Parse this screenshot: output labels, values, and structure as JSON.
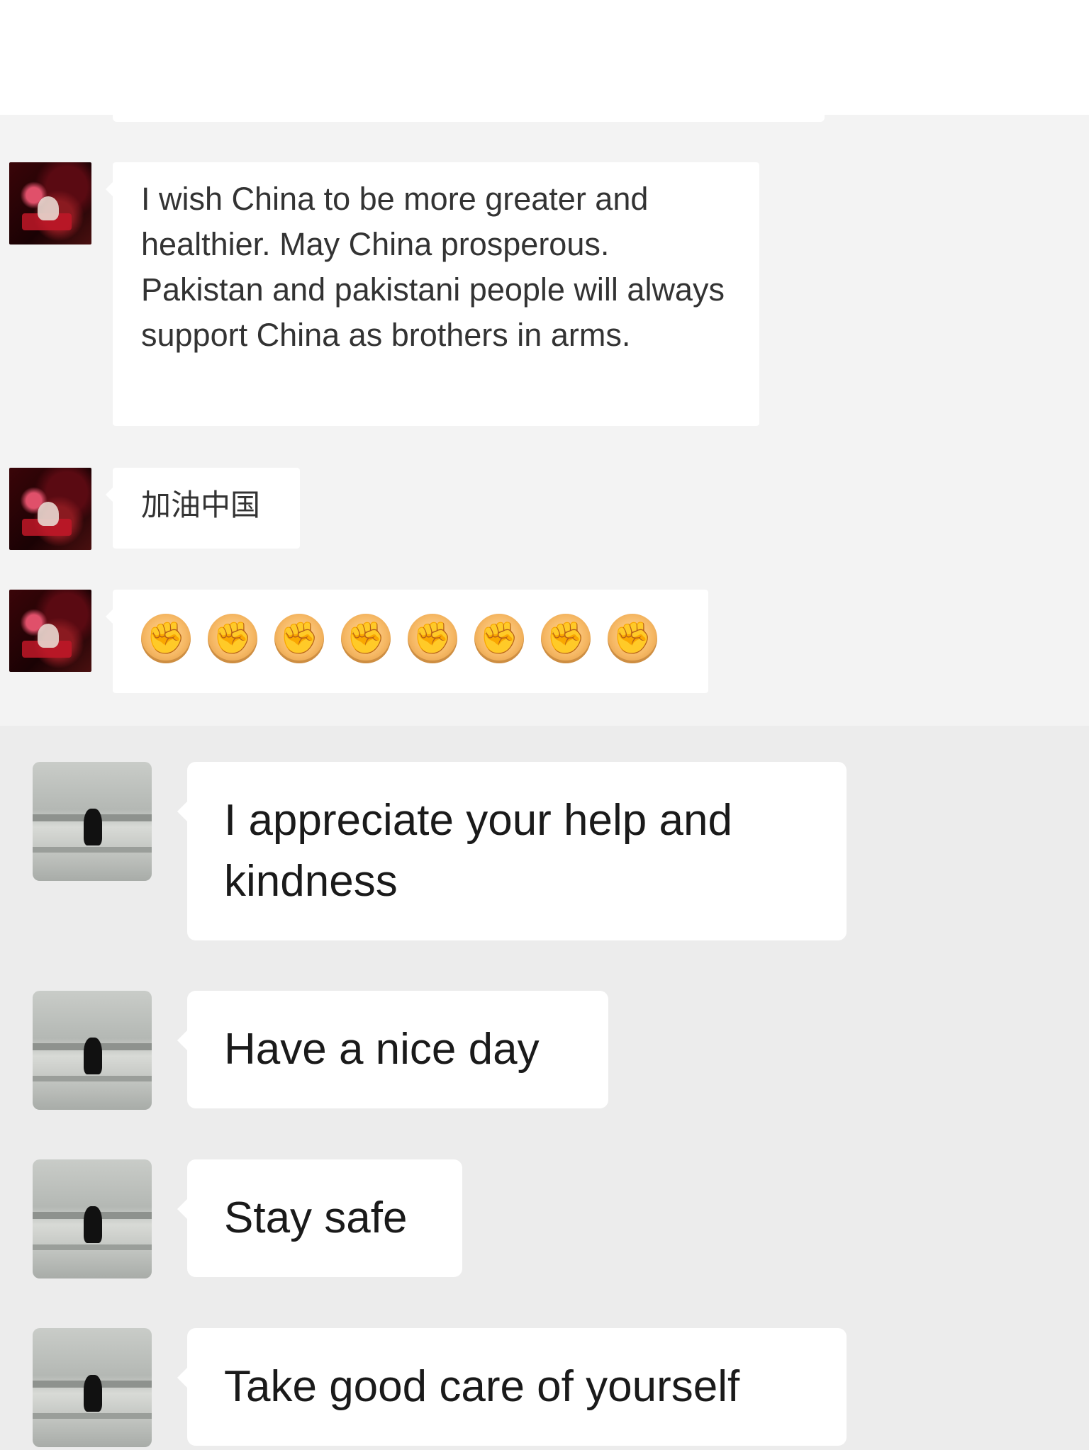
{
  "messages_group_a": [
    {
      "id": "msg-wish",
      "text": "I wish China to be more greater and healthier. May China prosperous. Pakistan and pakistani people will always support China as brothers in arms."
    },
    {
      "id": "msg-jiayou",
      "text": "加油中国"
    },
    {
      "id": "msg-fists",
      "emoji_name": "fist-bump-icon",
      "count": 8,
      "glyph": "✊"
    }
  ],
  "messages_group_b": [
    {
      "id": "msg-appreciate",
      "text": "I appreciate your help and kindness"
    },
    {
      "id": "msg-nice-day",
      "text": "Have a nice day"
    },
    {
      "id": "msg-stay-safe",
      "text": "Stay safe"
    },
    {
      "id": "msg-take-care",
      "text": "Take good care of yourself"
    }
  ],
  "colors": {
    "chat_bg_a": "#f3f3f3",
    "chat_bg_b": "#ececec",
    "bubble_bg": "#ffffff"
  }
}
